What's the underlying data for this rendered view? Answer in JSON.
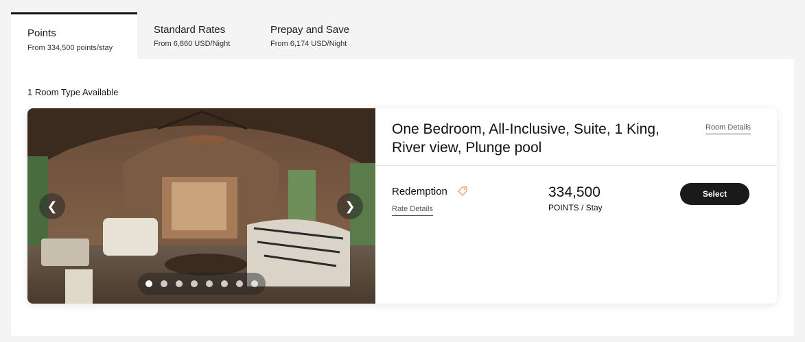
{
  "tabs": [
    {
      "title": "Points",
      "subtitle": "From 334,500 points/stay",
      "active": true
    },
    {
      "title": "Standard Rates",
      "subtitle": "From 6,860 USD/Night",
      "active": false
    },
    {
      "title": "Prepay and Save",
      "subtitle": "From 6,174 USD/Night",
      "active": false
    }
  ],
  "rooms_available": "1 Room Type Available",
  "room": {
    "name": "One Bedroom, All-Inclusive, Suite, 1 King, River view, Plunge pool",
    "details_link": "Room Details",
    "gallery": {
      "image_count": 8,
      "current_index": 0,
      "prev_icon": "chevron-left-icon",
      "next_icon": "chevron-right-icon"
    },
    "rate": {
      "name": "Redemption",
      "tag_icon": "tag-icon",
      "details_link": "Rate Details",
      "points": "334,500",
      "unit": "POINTS / Stay",
      "select_label": "Select"
    }
  },
  "colors": {
    "page_bg": "#f4f4f4",
    "panel_bg": "#ffffff",
    "button_bg": "#1a1a1a",
    "tag_accent": "#e8a27a"
  }
}
